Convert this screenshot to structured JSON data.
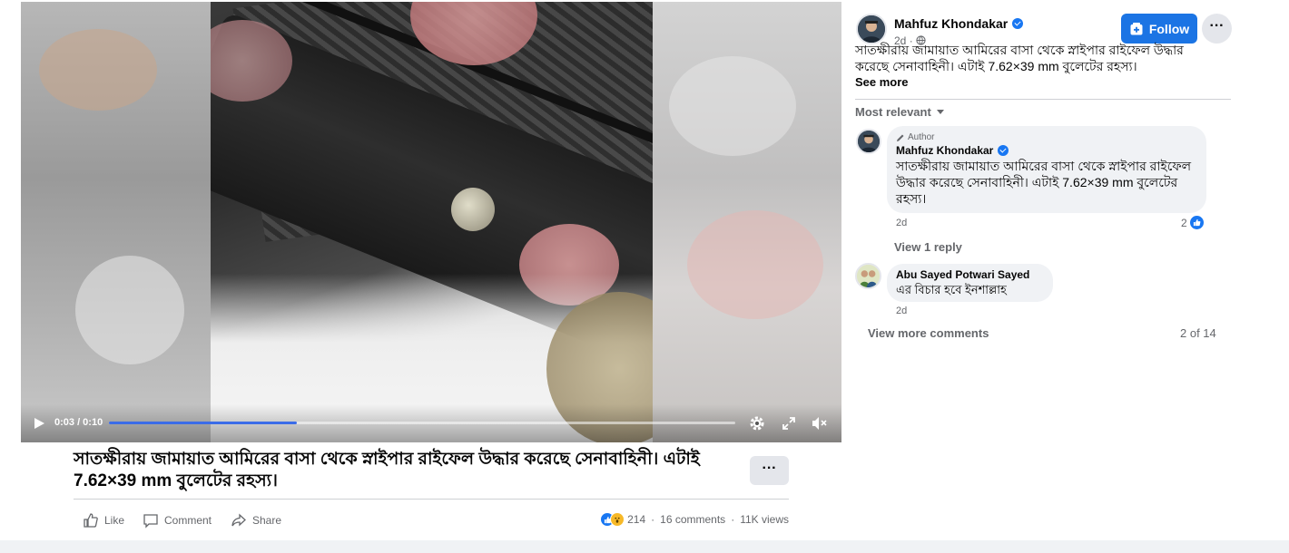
{
  "video": {
    "time_label": "0:03 / 0:10",
    "progress_fraction": 0.3
  },
  "post": {
    "caption": "সাতক্ষীরায় জামায়াত আমিরের বাসা থেকে স্নাইপার রাইফেল উদ্ধার করেছে সেনাবাহিনী। এটাই 7.62×39 mm বুলেটের রহস্য।",
    "more_label": "···",
    "actions": {
      "like": "Like",
      "comment": "Comment",
      "share": "Share"
    },
    "stats": {
      "reactions": "214",
      "comments": "16 comments",
      "views": "11K views"
    }
  },
  "panel": {
    "author": "Mahfuz Khondakar",
    "time": "2d",
    "follow_label": "Follow",
    "menu_label": "···",
    "post_text": "সাতক্ষীরায় জামায়াত আমিরের বাসা থেকে স্নাইপার রাইফেল উদ্ধার করেছে সেনাবাহিনী। এটাই 7.62×39 mm বুলেটের রহস্য।",
    "see_more": "See more",
    "sort_label": "Most relevant"
  },
  "comments": [
    {
      "badge": "Author",
      "name": "Mahfuz Khondakar",
      "text": "সাতক্ষীরায় জামায়াত আমিরের বাসা থেকে স্নাইপার রাইফেল উদ্ধার করেছে সেনাবাহিনী। এটাই 7.62×39 mm বুলেটের রহস্য।",
      "time": "2d",
      "likes": "2",
      "replies_label": "View 1 reply"
    },
    {
      "name": "Abu Sayed Potwari Sayed",
      "text": "এর বিচার হবে ইনশাল্লাহ",
      "time": "2d"
    }
  ],
  "view_more": "View more comments",
  "pager": "2 of 14",
  "colors": {
    "accent": "#1b74e4",
    "like_blue": "#1877f2",
    "bubble": "#f0f2f5",
    "muted": "#65676b"
  }
}
